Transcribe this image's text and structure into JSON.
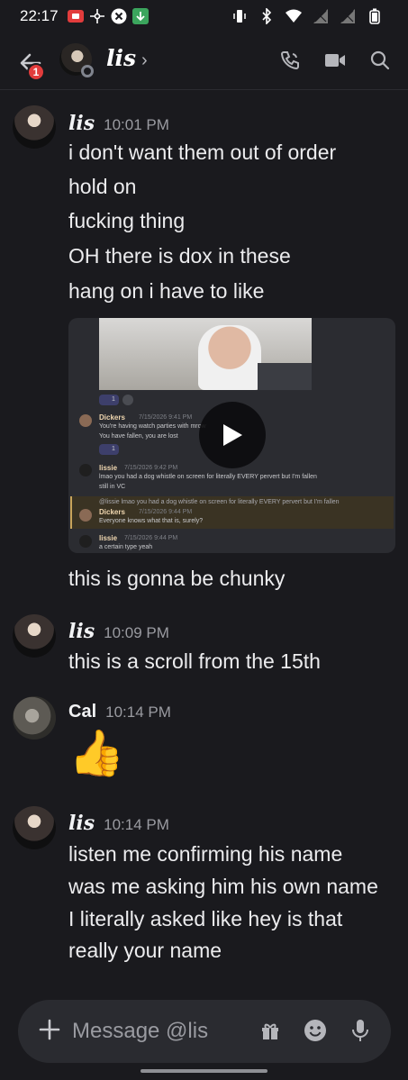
{
  "status_bar": {
    "time": "22:17"
  },
  "header": {
    "name": "lis",
    "badge_count": "1"
  },
  "messages": [
    {
      "author": "lis",
      "time": "10:01 PM",
      "lines": [
        "i don't want them out of order",
        "hold on",
        "fucking thing",
        "OH there is dox in these",
        "hang on i have to like"
      ]
    },
    {
      "after_video": "this is gonna be chunky"
    },
    {
      "author": "lis",
      "time": "10:09 PM",
      "lines": [
        "this is a scroll from the 15th"
      ]
    },
    {
      "author": "Cal",
      "time": "10:14 PM",
      "emoji": "👍"
    },
    {
      "author": "lis",
      "time": "10:14 PM",
      "lines": [
        "listen me confirming his name",
        "was me asking him his own name",
        "I literally asked like hey is that",
        "really your name"
      ]
    }
  ],
  "video": {
    "react_count_1": "1",
    "msg1_author": "Dickers",
    "msg1_time": "7/15/2026 9:41 PM",
    "msg1_line1": "You're having watch parties with mrow",
    "msg1_line2": "You have fallen, you are lost",
    "react_count_2": "1",
    "msg2_author": "lissie",
    "msg2_time": "7/15/2026 9:42 PM",
    "msg2_line1": "lmao you had a dog whistle on screen for literally EVERY pervert but I'm fallen",
    "msg2_line2": "still in VC",
    "reply_preview": "@lissie lmao you had a dog whistle on screen for literally EVERY pervert but I'm fallen",
    "msg3_author": "Dickers",
    "msg3_time": "7/15/2026 9:44 PM",
    "msg3_line1": "Everyone knows what that is, surely?",
    "msg4_author": "lissie",
    "msg4_time": "7/15/2026 9:44 PM",
    "msg4_line1": "a certain type yeah"
  },
  "composer": {
    "placeholder": "Message @lis"
  },
  "colors": {
    "background": "#1a1a1e",
    "composer": "#2a2b30",
    "badge": "#e23c3c"
  }
}
